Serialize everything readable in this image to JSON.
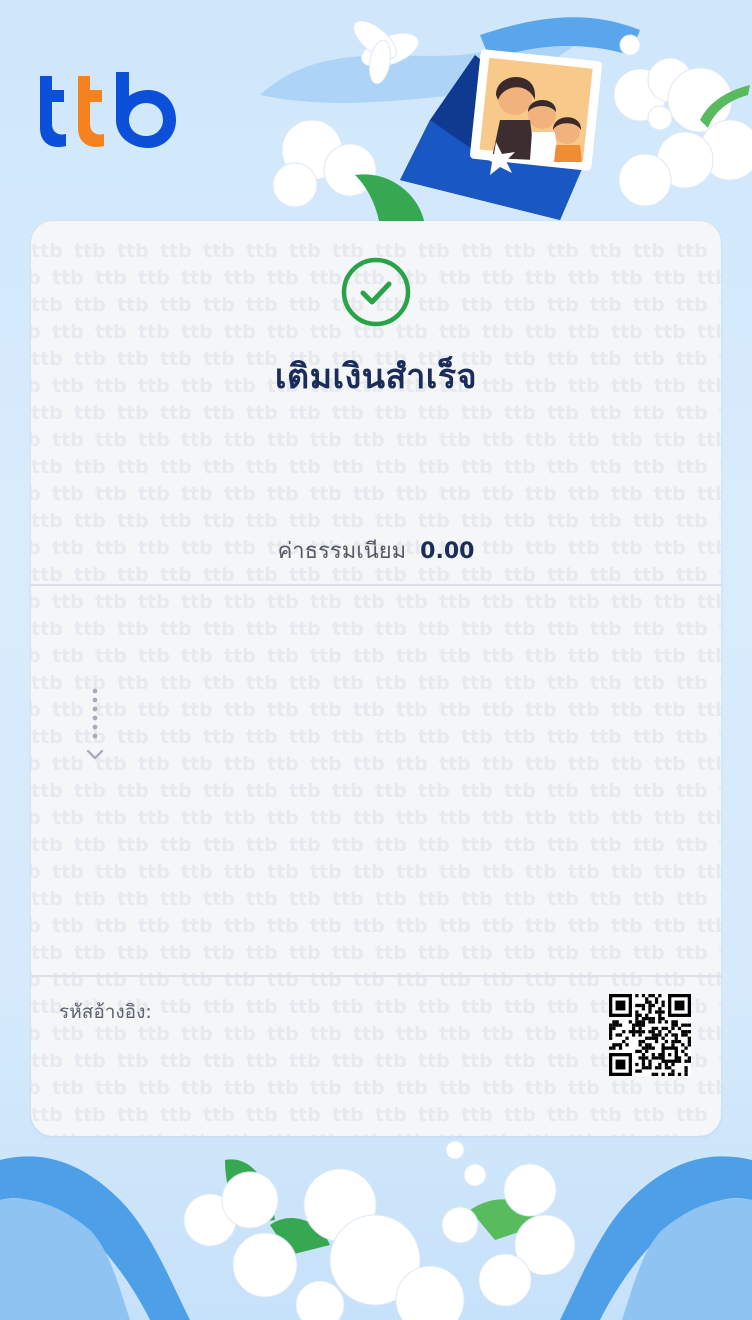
{
  "brand": {
    "name": "ttb",
    "colors": {
      "navy": "#1a4fa0",
      "orange": "#f5821f",
      "blue": "#0a4bd6"
    }
  },
  "receipt": {
    "status_icon": "check-circle-icon",
    "status_title": "เติมเงินสำเร็จ",
    "status_color": "#2aa24a",
    "fee_label": "ค่าธรรมเนียม",
    "fee_value": "0.00",
    "reference_label": "รหัสอ้างอิง:",
    "qr_icon": "qr-code-icon",
    "watermark_text": "ttb"
  }
}
